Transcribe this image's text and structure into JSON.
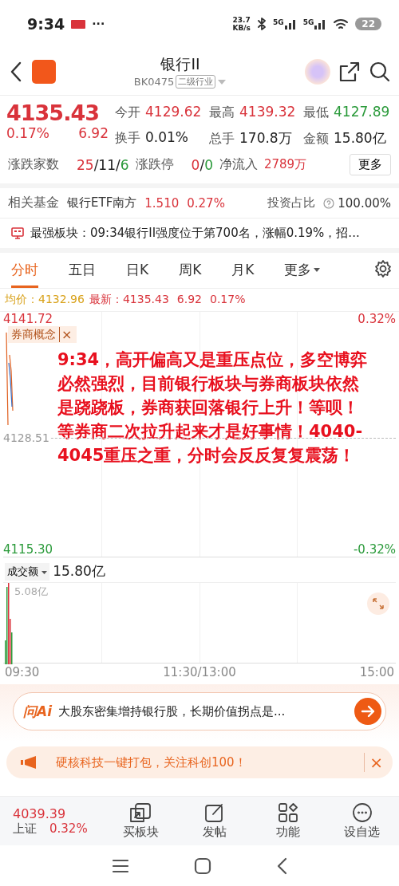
{
  "status_bar": {
    "time": "9:34",
    "more": "···",
    "speed_value": "23.7",
    "speed_unit": "KB/s",
    "networks": [
      "5G",
      "5G"
    ],
    "battery": "22"
  },
  "header": {
    "title": "银行II",
    "code": "BK0475",
    "tag": "二级行业"
  },
  "quote": {
    "price": "4135.43",
    "change_pct": "0.17%",
    "change": "6.92",
    "stats": [
      {
        "label": "今开",
        "value": "4129.62",
        "color": "#d9333b"
      },
      {
        "label": "最高",
        "value": "4139.32",
        "color": "#d9333b"
      },
      {
        "label": "最低",
        "value": "4127.89",
        "color": "#2a9a3a"
      },
      {
        "label": "换手",
        "value": "0.01%",
        "color": "#222222"
      },
      {
        "label": "总手",
        "value": "170.8万",
        "color": "#222222"
      },
      {
        "label": "金额",
        "value": "15.80亿",
        "color": "#222222"
      }
    ],
    "breadth": {
      "label": "涨跌家数",
      "parts": [
        {
          "text": "25",
          "color": "#d9333b"
        },
        {
          "text": "/11/",
          "color": "#222222"
        },
        {
          "text": "6",
          "color": "#2a9a3a"
        }
      ]
    },
    "limits": {
      "label": "涨跌停",
      "parts": [
        {
          "text": "0",
          "color": "#d9333b"
        },
        {
          "text": "/",
          "color": "#222222"
        },
        {
          "text": "0",
          "color": "#2a9a3a"
        }
      ]
    },
    "inflow": {
      "label": "净流入",
      "value": "2789万"
    },
    "more_button": "更多"
  },
  "fund": {
    "label": "相关基金",
    "name": "银行ETF南方",
    "price": "1.510",
    "pct": "0.27%",
    "ratio_label": "投资占比",
    "ratio": "100.00%"
  },
  "notice": "最强板块：09:34银行II强度位于第700名，涨幅0.19%，招...",
  "tabs": [
    {
      "label": "分时",
      "selected": true,
      "kind": "tab"
    },
    {
      "label": "五日",
      "selected": false,
      "kind": "tab"
    },
    {
      "label": "日K",
      "selected": false,
      "kind": "tab"
    },
    {
      "label": "周K",
      "selected": false,
      "kind": "tab"
    },
    {
      "label": "月K",
      "selected": false,
      "kind": "tab"
    },
    {
      "label": "更多",
      "selected": false,
      "kind": "dropdown"
    }
  ],
  "price_line": {
    "avg_label": "均价：4132.96",
    "latest_label": "最新：4135.43",
    "change": "6.92",
    "pct": "0.17%"
  },
  "chart": {
    "high": "4141.72",
    "high_pct": "0.32%",
    "mid": "4128.51",
    "low": "4115.30",
    "low_pct": "-0.32%",
    "tag": "券商概念",
    "tag_close": "×",
    "note": "9:34，高开偏高又是重压点位，多空博弈必然强烈，目前银行板块与券商板块依然是跷跷板，券商获回落银行上升！等呗！等券商二次拉升起来才是好事情！4040-4045重压之重，分时会反反复复震荡！"
  },
  "volume": {
    "selector": "成交额",
    "total": "15.80亿",
    "max": "5.08亿",
    "times": [
      "09:30",
      "11:30/13:00",
      "15:00"
    ]
  },
  "ai": {
    "logo": "问Ai",
    "query": "大股东密集增持银行股，长期价值拐点是..."
  },
  "banner": {
    "text": "硬核科技一键打包，关注科创100！",
    "close": "×"
  },
  "bottom_nav": {
    "index": {
      "value": "4039.39",
      "name": "上证",
      "pct": "0.32%"
    },
    "items": [
      {
        "label": "买板块",
        "kind": "buy"
      },
      {
        "label": "发帖",
        "kind": "post"
      },
      {
        "label": "功能",
        "kind": "grid"
      },
      {
        "label": "设自选",
        "kind": "more"
      }
    ]
  }
}
